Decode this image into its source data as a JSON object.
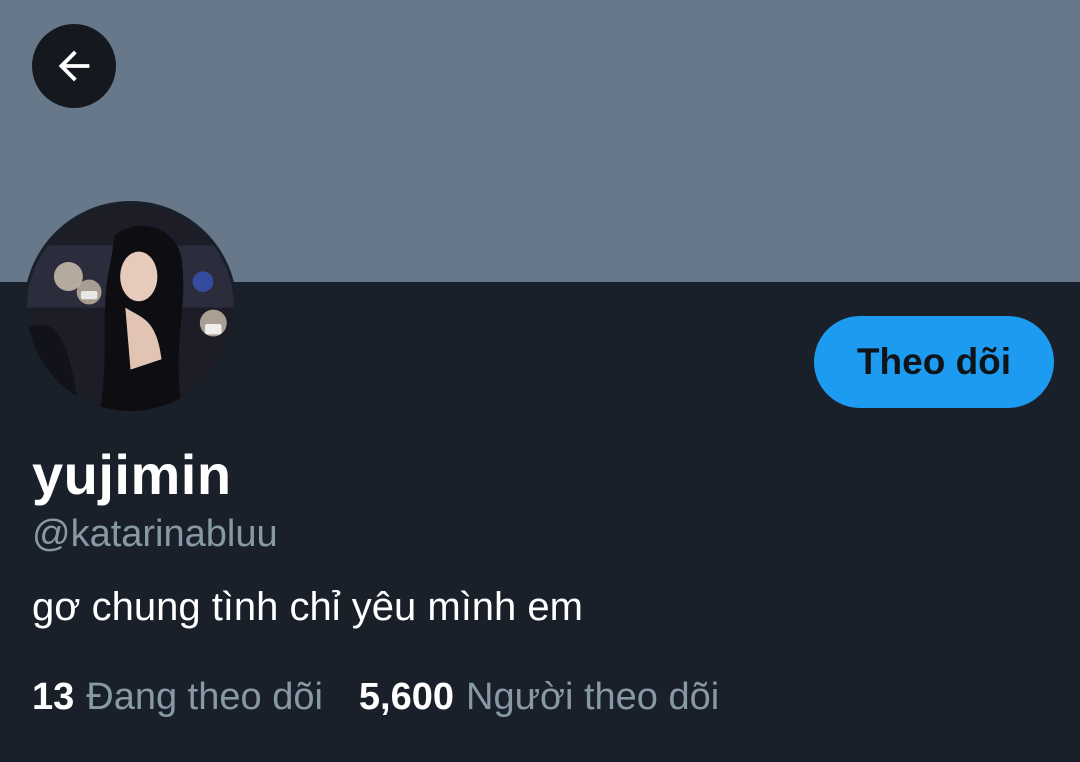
{
  "profile": {
    "display_name": "yujimin",
    "handle": "@katarinabluu",
    "bio": "gơ chung tình chỉ yêu mình em",
    "follow_label": "Theo dõi",
    "avatar_alt": "Profile photo"
  },
  "stats": {
    "following_count": "13",
    "following_label": "Đang theo dõi",
    "followers_count": "5,600",
    "followers_label": "Người theo dõi"
  },
  "icons": {
    "back": "back-arrow-icon"
  },
  "colors": {
    "banner": "#66788a",
    "background": "#19202a",
    "accent": "#1d9bf0",
    "secondary_text": "#8899a6"
  }
}
